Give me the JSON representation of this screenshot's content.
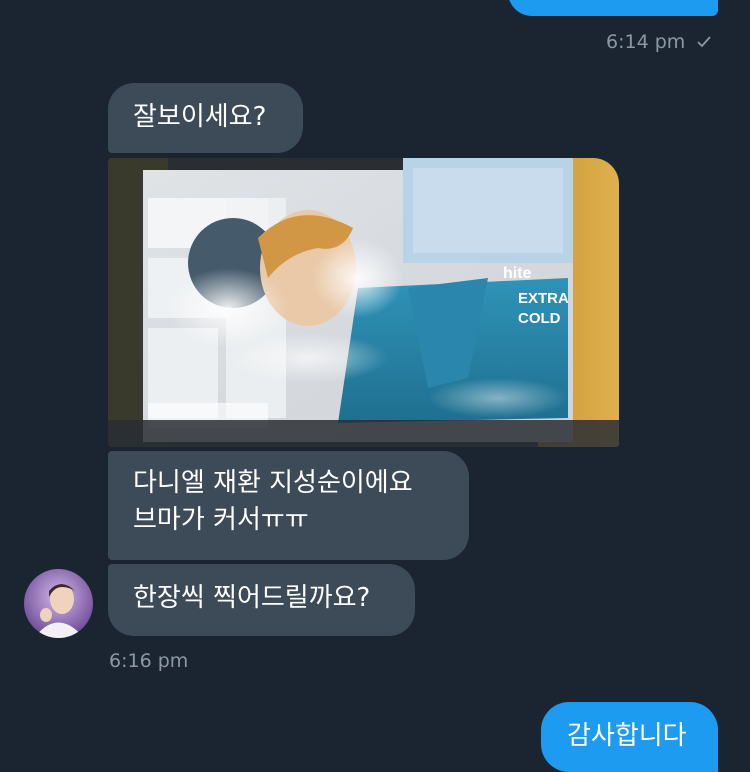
{
  "thread": {
    "sent_top": {
      "timestamp": "6:14 pm",
      "read_icon": "checkmark-icon"
    },
    "received": {
      "msg1": "잘보이세요?",
      "photo_alt": "poster in plastic sleeve",
      "msg2_line1": "다니엘 재환 지성순이에요",
      "msg2_line2": "브마가 커서ㅠㅠ",
      "msg3": "한장씩 찍어드릴까요?",
      "timestamp": "6:16 pm",
      "avatar": "avatar-photo"
    },
    "sent_bottom": {
      "text": "감사합니다"
    }
  },
  "colors": {
    "background": "#1b2532",
    "incoming_bubble": "#3d4a57",
    "outgoing_bubble": "#1d9bf0",
    "timestamp": "#8b98a5"
  }
}
